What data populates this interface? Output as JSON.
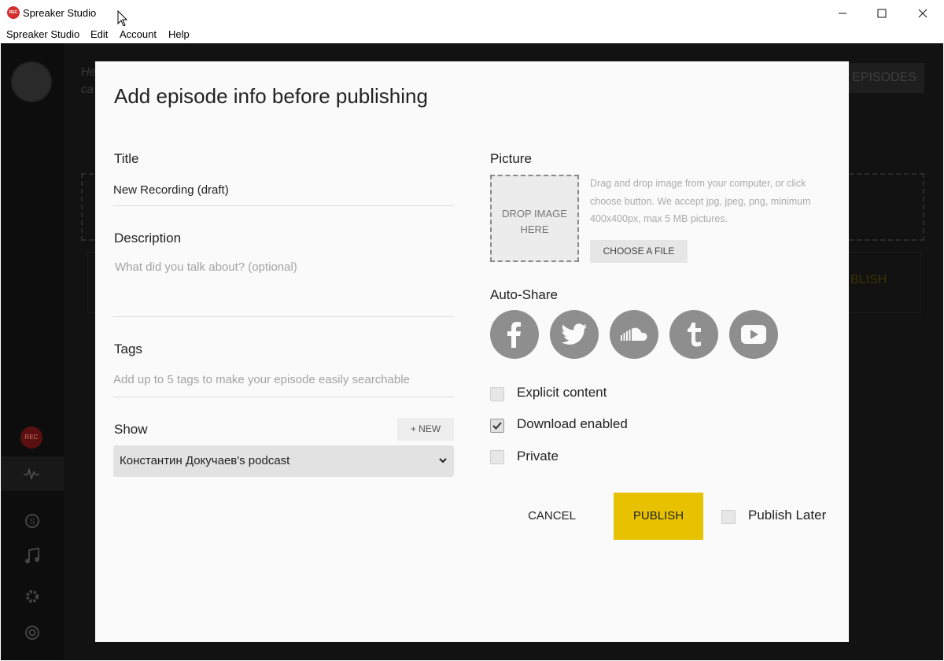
{
  "window": {
    "title": "Spreaker Studio",
    "app_icon_text": "REC"
  },
  "menu": [
    "Spreaker Studio",
    "Edit",
    "Account",
    "Help"
  ],
  "background": {
    "header_text": "He ca",
    "episodes_button": "EPISODES",
    "publish_text": "BLISH",
    "rec_label": "REC"
  },
  "modal": {
    "title": "Add episode info before publishing",
    "title_field": {
      "label": "Title",
      "value": "New Recording (draft)"
    },
    "description_field": {
      "label": "Description",
      "placeholder": "What did you talk about? (optional)"
    },
    "tags_field": {
      "label": "Tags",
      "placeholder": "Add up to 5 tags to make your episode easily searchable"
    },
    "show_field": {
      "label": "Show",
      "new_button": "+ NEW",
      "selected": "Константин Докучаев's podcast"
    },
    "picture": {
      "label": "Picture",
      "drop_text_line1": "DROP IMAGE",
      "drop_text_line2": "HERE",
      "help": "Drag and drop image from your computer, or click choose button. We accept jpg, jpeg, png, minimum 400x400px, max 5 MB pictures.",
      "choose_button": "CHOOSE A FILE"
    },
    "auto_share": {
      "label": "Auto-Share",
      "services": [
        "facebook-icon",
        "twitter-icon",
        "soundcloud-icon",
        "tumblr-icon",
        "youtube-icon"
      ]
    },
    "options": [
      {
        "label": "Explicit content",
        "checked": false
      },
      {
        "label": "Download enabled",
        "checked": true
      },
      {
        "label": "Private",
        "checked": false
      }
    ],
    "actions": {
      "cancel": "CANCEL",
      "publish": "PUBLISH",
      "publish_later": "Publish Later"
    }
  },
  "colors": {
    "accent": "#e8c200",
    "social_icon_bg": "#8e8e8e",
    "app_background": "#121212"
  }
}
